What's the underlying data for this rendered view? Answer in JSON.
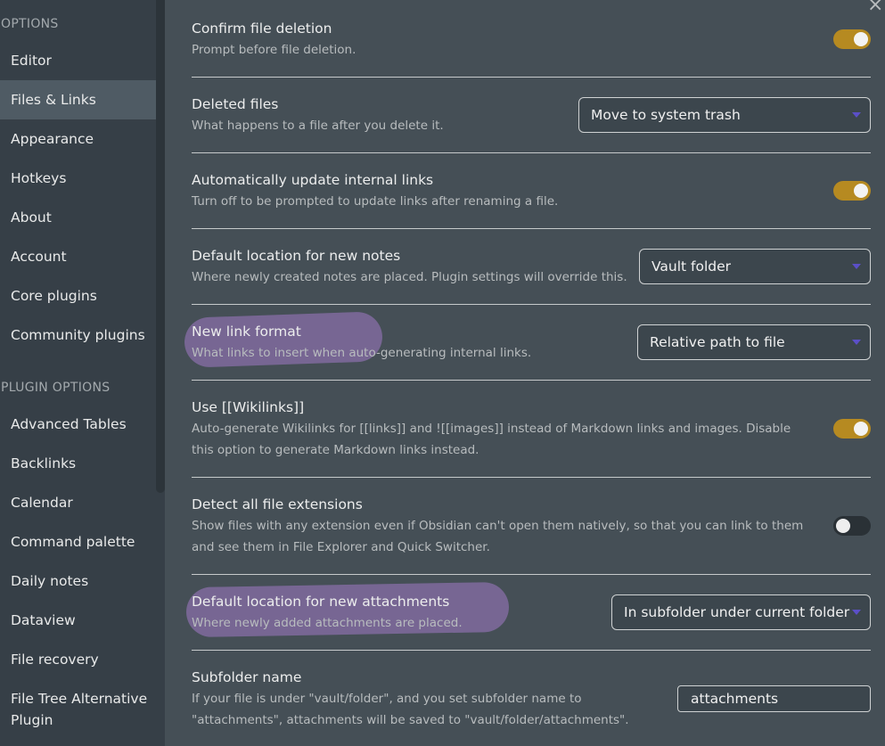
{
  "sidebar": {
    "options_heading": "OPTIONS",
    "options_items": [
      {
        "label": "Editor"
      },
      {
        "label": "Files & Links",
        "active": true
      },
      {
        "label": "Appearance"
      },
      {
        "label": "Hotkeys"
      },
      {
        "label": "About"
      },
      {
        "label": "Account"
      },
      {
        "label": "Core plugins"
      },
      {
        "label": "Community plugins"
      }
    ],
    "plugin_heading": "PLUGIN OPTIONS",
    "plugin_items": [
      {
        "label": "Advanced Tables"
      },
      {
        "label": "Backlinks"
      },
      {
        "label": "Calendar"
      },
      {
        "label": "Command palette"
      },
      {
        "label": "Daily notes"
      },
      {
        "label": "Dataview"
      },
      {
        "label": "File recovery"
      },
      {
        "label": "File Tree Alternative Plugin"
      }
    ]
  },
  "main": {
    "close_icon": "×",
    "settings": [
      {
        "name": "Confirm file deletion",
        "desc": "Prompt before file deletion.",
        "control": "toggle",
        "on": true
      },
      {
        "name": "Deleted files",
        "desc": "What happens to a file after you delete it.",
        "control": "dropdown",
        "value": "Move to system trash"
      },
      {
        "name": "Automatically update internal links",
        "desc": "Turn off to be prompted to update links after renaming a file.",
        "control": "toggle",
        "on": true
      },
      {
        "name": "Default location for new notes",
        "desc": "Where newly created notes are placed. Plugin settings will override this.",
        "control": "dropdown",
        "value": "Vault folder"
      },
      {
        "name": "New link format",
        "desc": "What links to insert when auto-generating internal links.",
        "control": "dropdown",
        "value": "Relative path to file",
        "highlighted": true
      },
      {
        "name": "Use [[Wikilinks]]",
        "desc": "Auto-generate Wikilinks for [[links]] and ![[images]] instead of Markdown links and images. Disable this option to generate Markdown links instead.",
        "control": "toggle",
        "on": true
      },
      {
        "name": "Detect all file extensions",
        "desc": "Show files with any extension even if Obsidian can't open them natively, so that you can link to them and see them in File Explorer and Quick Switcher.",
        "control": "toggle",
        "on": false
      },
      {
        "name": "Default location for new attachments",
        "desc": "Where newly added attachments are placed.",
        "control": "dropdown",
        "value": "In subfolder under current folder",
        "highlighted": true
      },
      {
        "name": "Subfolder name",
        "desc": "If your file is under \"vault/folder\", and you set subfolder name to \"attachments\", attachments will be saved to \"vault/folder/attachments\".",
        "control": "text",
        "value": "attachments"
      }
    ]
  },
  "colors": {
    "accent_toggle": "#b68a21",
    "highlight": "#a07ac6",
    "sidebar_bg": "#363f47",
    "main_bg": "#454f56"
  }
}
